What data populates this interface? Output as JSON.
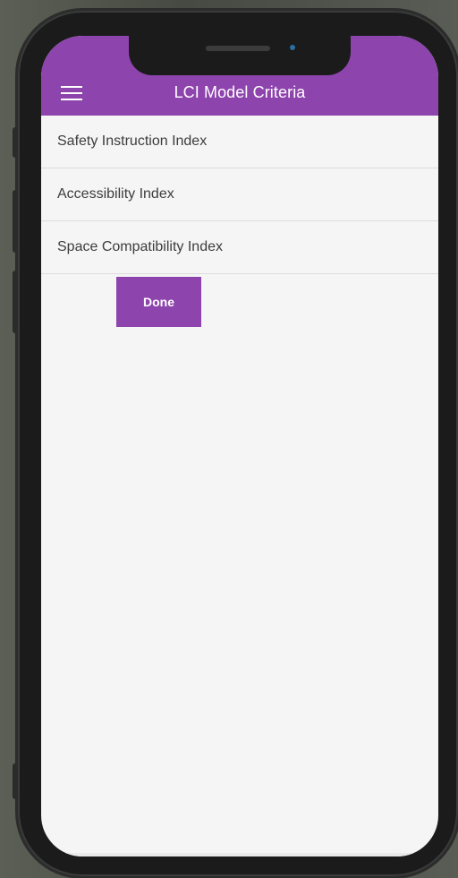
{
  "header": {
    "title": "LCI Model Criteria",
    "menu_icon": "hamburger-menu-icon"
  },
  "criteria": {
    "items": [
      {
        "label": "Safety Instruction Index"
      },
      {
        "label": "Accessibility Index"
      },
      {
        "label": "Space Compatibility Index"
      }
    ]
  },
  "actions": {
    "done_label": "Done"
  },
  "colors": {
    "accent": "#8e44ad",
    "screen_background": "#f5f5f5",
    "text": "#3d3d3d",
    "divider": "#dcdcdc"
  }
}
